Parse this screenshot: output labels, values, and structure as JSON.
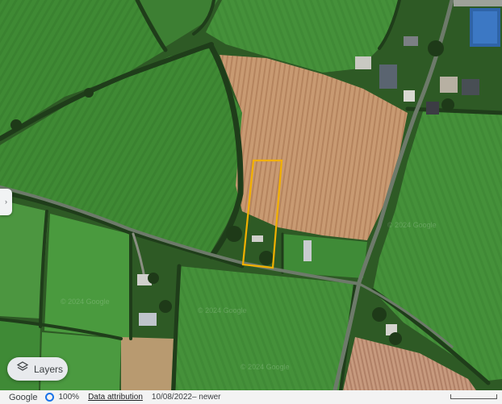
{
  "map": {
    "watermark": "© 2024 Google",
    "highlight_color": "#f2b000"
  },
  "controls": {
    "side_panel_chevron": "›",
    "layers_label": "Layers"
  },
  "footer": {
    "logo": "Google",
    "zoom": "100%",
    "attribution": "Data attribution",
    "imagery_date": "10/08/2022– newer"
  }
}
